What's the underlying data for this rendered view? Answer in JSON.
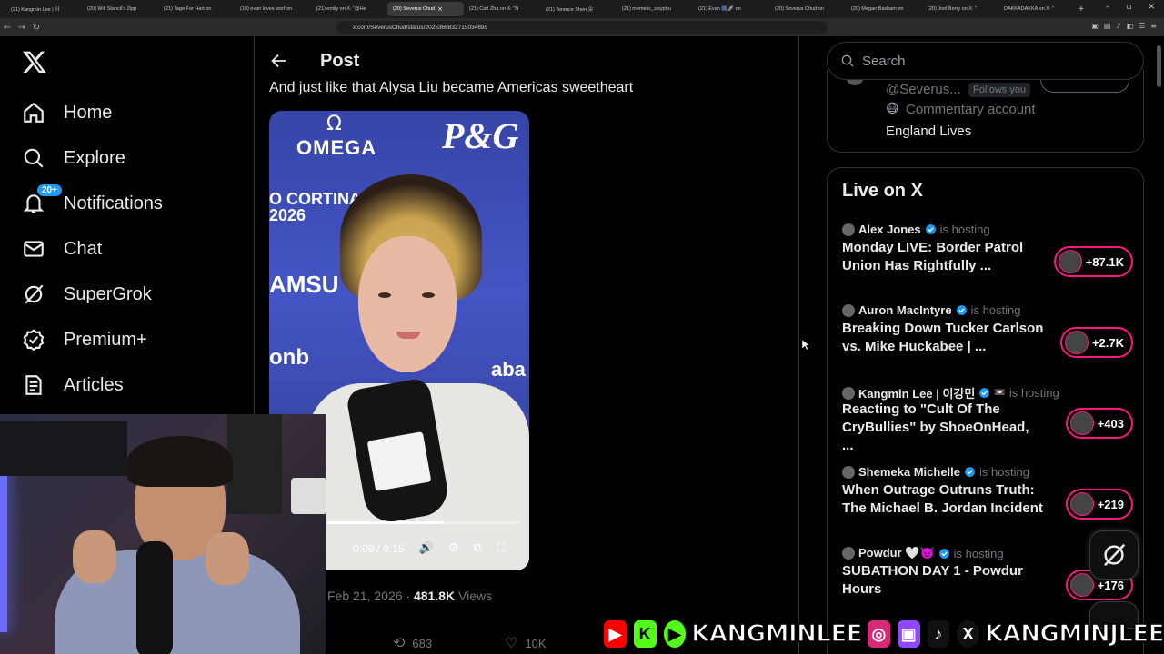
{
  "browser": {
    "tabs": [
      {
        "label": "(21) Kangmin Lee | 이"
      },
      {
        "label": "(20) Will Stancil's Zipp"
      },
      {
        "label": "(21) Tage For Hart on"
      },
      {
        "label": "(19) evan loves worf on"
      },
      {
        "label": "(21) emily on X: \"@He"
      },
      {
        "label": "(20) Severus Chud",
        "active": true
      },
      {
        "label": "(21) Carl Zha on X: \"N"
      },
      {
        "label": "(21) Terence Shen 尖"
      },
      {
        "label": "(21) memetic_sisyphu"
      },
      {
        "label": "(21) Evan 🎆🚀 on"
      },
      {
        "label": "(20) Severus Chud on"
      },
      {
        "label": "(20) Megan Basham on"
      },
      {
        "label": "(20) Joel Berry on X: \""
      },
      {
        "label": "DAKKADAKKA on X: \""
      }
    ],
    "url": "x.com/SeverusChud/status/2025366832715034695"
  },
  "nav": {
    "items": [
      {
        "label": "Home",
        "icon": "home-icon"
      },
      {
        "label": "Explore",
        "icon": "search-icon"
      },
      {
        "label": "Notifications",
        "icon": "bell-icon"
      },
      {
        "label": "Chat",
        "icon": "mail-icon"
      },
      {
        "label": "SuperGrok",
        "icon": "grok-icon"
      },
      {
        "label": "Premium+",
        "icon": "premium-icon"
      },
      {
        "label": "Articles",
        "icon": "articles-icon"
      }
    ],
    "notifications_badge": "20+"
  },
  "post": {
    "header_title": "Post",
    "text": "And just like that Alysa Liu became Americas sweetheart",
    "video": {
      "sponsor_logos": [
        "OMEGA",
        "Ω",
        "P&G",
        "O CORTINA",
        "2026",
        "AMSU",
        "onb",
        "aba"
      ],
      "time": "0:09 / 0:15",
      "progress": 0.6
    },
    "date": "Feb 21, 2026",
    "views_count": "481.8K",
    "views_label": "Views",
    "reposts": "683",
    "likes": "10K"
  },
  "search": {
    "placeholder": "Search"
  },
  "who_card": {
    "handle": "@Severus...",
    "follows_you": "Follows you",
    "commentary_emoji": "😷",
    "commentary": "Commentary account",
    "bio": "England Lives"
  },
  "live": {
    "title": "Live on X",
    "is_hosting": "is hosting",
    "items": [
      {
        "host": "Alex Jones",
        "extra": "",
        "title": "Monday LIVE: Border Patrol Union Has Rightfully ...",
        "count": "+87.1K"
      },
      {
        "host": "Auron MacIntyre",
        "extra": "",
        "title": "Breaking Down Tucker Carlson vs. Mike Huckabee | ...",
        "count": "+2.7K"
      },
      {
        "host": "Kangmin Lee | 이강민",
        "extra": "📼",
        "title": "Reacting to \"Cult Of The CryBullies\" by ShoeOnHead, ...",
        "count": "+403"
      },
      {
        "host": "Shemeka Michelle",
        "extra": "",
        "title": "When Outrage Outruns Truth: The Michael B. Jordan Incident",
        "count": "+219"
      },
      {
        "host": "Powdur 🤍😈",
        "extra": "",
        "title": "SUBATHON DAY 1 - Powdur Hours",
        "count": "+176"
      }
    ]
  },
  "banner": {
    "left_text": "KANGMINLEE",
    "right_text": "KANGMINJLEE"
  },
  "colors": {
    "accent": "#1d9bf0",
    "live_pink": "#f91880",
    "border": "#2f3336"
  }
}
